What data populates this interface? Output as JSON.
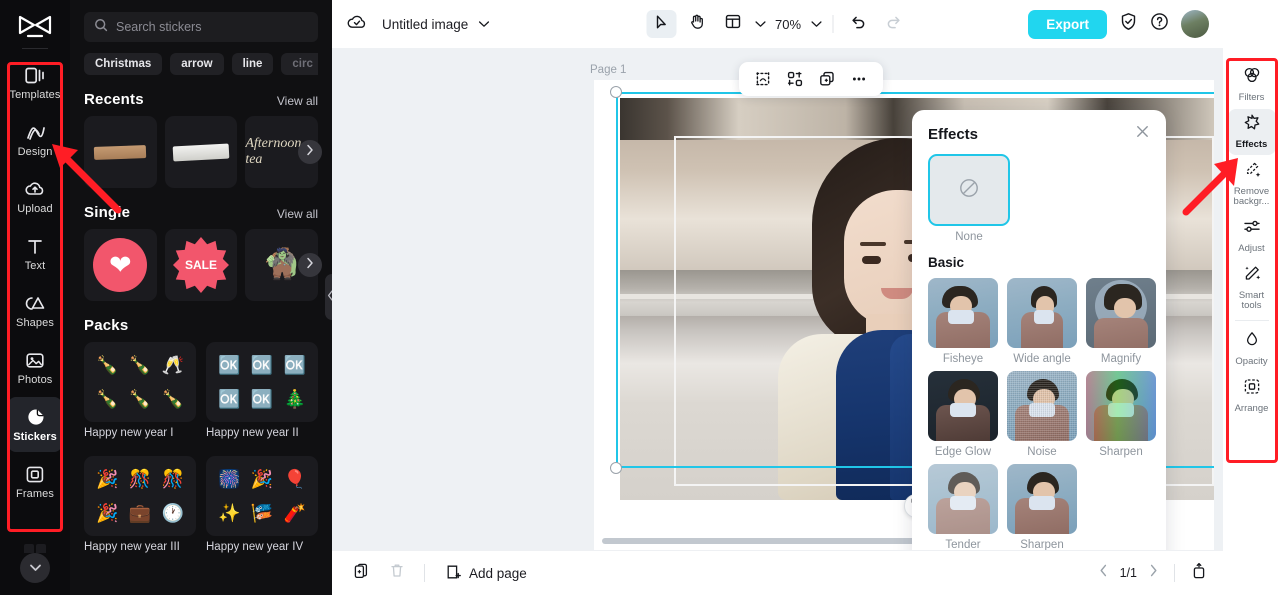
{
  "left_rail": {
    "logo_name": "capcut-logo",
    "items": [
      {
        "label": "Templates",
        "icon": "templates-icon",
        "active": false
      },
      {
        "label": "Design",
        "icon": "design-icon",
        "active": false
      },
      {
        "label": "Upload",
        "icon": "upload-cloud-icon",
        "active": false
      },
      {
        "label": "Text",
        "icon": "text-icon",
        "active": false
      },
      {
        "label": "Shapes",
        "icon": "shapes-icon",
        "active": false
      },
      {
        "label": "Photos",
        "icon": "photos-icon",
        "active": false
      },
      {
        "label": "Stickers",
        "icon": "stickers-icon",
        "active": true
      },
      {
        "label": "Frames",
        "icon": "frames-icon",
        "active": false
      }
    ],
    "expand_icon": "chevron-down-icon"
  },
  "stickers_panel": {
    "search": {
      "placeholder": "Search stickers",
      "value": "",
      "icon": "search-icon"
    },
    "chips": [
      "Christmas",
      "arrow",
      "line",
      "circ"
    ],
    "sections": [
      {
        "title": "Recents",
        "view_all": "View all",
        "tiles": [
          {
            "name": "tape-sticker",
            "glyph": "🟫"
          },
          {
            "name": "torn-paper-sticker",
            "glyph": "📄"
          },
          {
            "name": "afternoon-tea-sticker",
            "glyph": "✍"
          }
        ]
      },
      {
        "title": "Single",
        "view_all": "View all",
        "tiles": [
          {
            "name": "heart-sticker",
            "glyph": "❤"
          },
          {
            "name": "sale-badge-sticker",
            "glyph": "SALE"
          },
          {
            "name": "reindeer-sticker",
            "glyph": "🦌"
          }
        ]
      }
    ],
    "packs_title": "Packs",
    "packs": [
      {
        "label": "Happy new year I",
        "glyphs": [
          "🍾",
          "🍾",
          "🥂",
          "🍾",
          "🍾",
          "🍾"
        ]
      },
      {
        "label": "Happy new year II",
        "glyphs": [
          "🆗",
          "🆗",
          "🆗",
          "🆗",
          "🆗",
          "🎄"
        ]
      },
      {
        "label": "Happy new year III",
        "glyphs": [
          "🎉",
          "🎊",
          "🎊",
          "🎉",
          "💼",
          "🕐"
        ]
      },
      {
        "label": "Happy new year IV",
        "glyphs": [
          "🎆",
          "🎉",
          "🎈",
          "✨",
          "🎏",
          "🧨"
        ]
      }
    ],
    "collapse_icon": "chevron-left-icon",
    "next_icon": "chevron-right-icon"
  },
  "topbar": {
    "cloud_icon": "cloud-saved-icon",
    "doc_title": "Untitled image",
    "title_caret": "chevron-down-icon",
    "select_tool": "cursor-select-icon",
    "hand_tool": "hand-pan-icon",
    "layout_tool": "layout-icon",
    "layout_caret": "chevron-down-icon",
    "zoom_value": "70%",
    "zoom_caret": "chevron-down-icon",
    "undo_icon": "undo-icon",
    "redo_icon": "redo-icon",
    "export_label": "Export",
    "shield_icon": "shield-check-icon",
    "help_icon": "help-circle-icon",
    "avatar_name": "user-avatar"
  },
  "canvas": {
    "page_label": "Page 1",
    "object_toolbar": [
      {
        "name": "crop-icon"
      },
      {
        "name": "mask-icon"
      },
      {
        "name": "duplicate-icon"
      },
      {
        "name": "more-options-icon"
      }
    ],
    "rotate_icon": "rotate-handle-icon",
    "selection_color": "#20c6e8"
  },
  "effects_panel": {
    "title": "Effects",
    "close_icon": "close-icon",
    "none_label": "None",
    "none_icon": "no-effect-icon",
    "group_title": "Basic",
    "effects": [
      {
        "label": "Fisheye",
        "style": "fisheye"
      },
      {
        "label": "Wide angle",
        "style": "wide"
      },
      {
        "label": "Magnify",
        "style": "magnify"
      },
      {
        "label": "Edge Glow",
        "style": "edge-glow"
      },
      {
        "label": "Noise",
        "style": "noise"
      },
      {
        "label": "Sharpen",
        "style": "sharpen"
      },
      {
        "label": "Tender",
        "style": "tender"
      },
      {
        "label": "Sharpen",
        "style": "sharpen2"
      }
    ]
  },
  "right_tools": {
    "items": [
      {
        "label": "Filters",
        "icon": "filters-icon",
        "active": false
      },
      {
        "label": "Effects",
        "icon": "effects-icon",
        "active": true
      },
      {
        "label": "Remove backgr...",
        "icon": "remove-background-icon",
        "active": false
      },
      {
        "label": "Adjust",
        "icon": "adjust-icon",
        "active": false
      },
      {
        "label": "Smart tools",
        "icon": "smart-tools-icon",
        "active": false
      },
      {
        "label": "Opacity",
        "icon": "opacity-icon",
        "active": false
      },
      {
        "label": "Arrange",
        "icon": "arrange-icon",
        "active": false
      }
    ]
  },
  "bottombar": {
    "duplicate_page_icon": "duplicate-page-icon",
    "delete_page_icon": "trash-icon",
    "add_page_icon": "add-page-icon",
    "add_page_label": "Add page",
    "prev_icon": "chevron-left-icon",
    "page_indicator": "1/1",
    "next_icon": "chevron-right-icon",
    "fullscreen_icon": "present-icon"
  },
  "annotations": {
    "color": "#ff1d25",
    "boxes": [
      "left-rail-tools",
      "right-tools-panel"
    ],
    "arrows": [
      "arrow-to-left-rail",
      "arrow-to-right-tools"
    ]
  }
}
